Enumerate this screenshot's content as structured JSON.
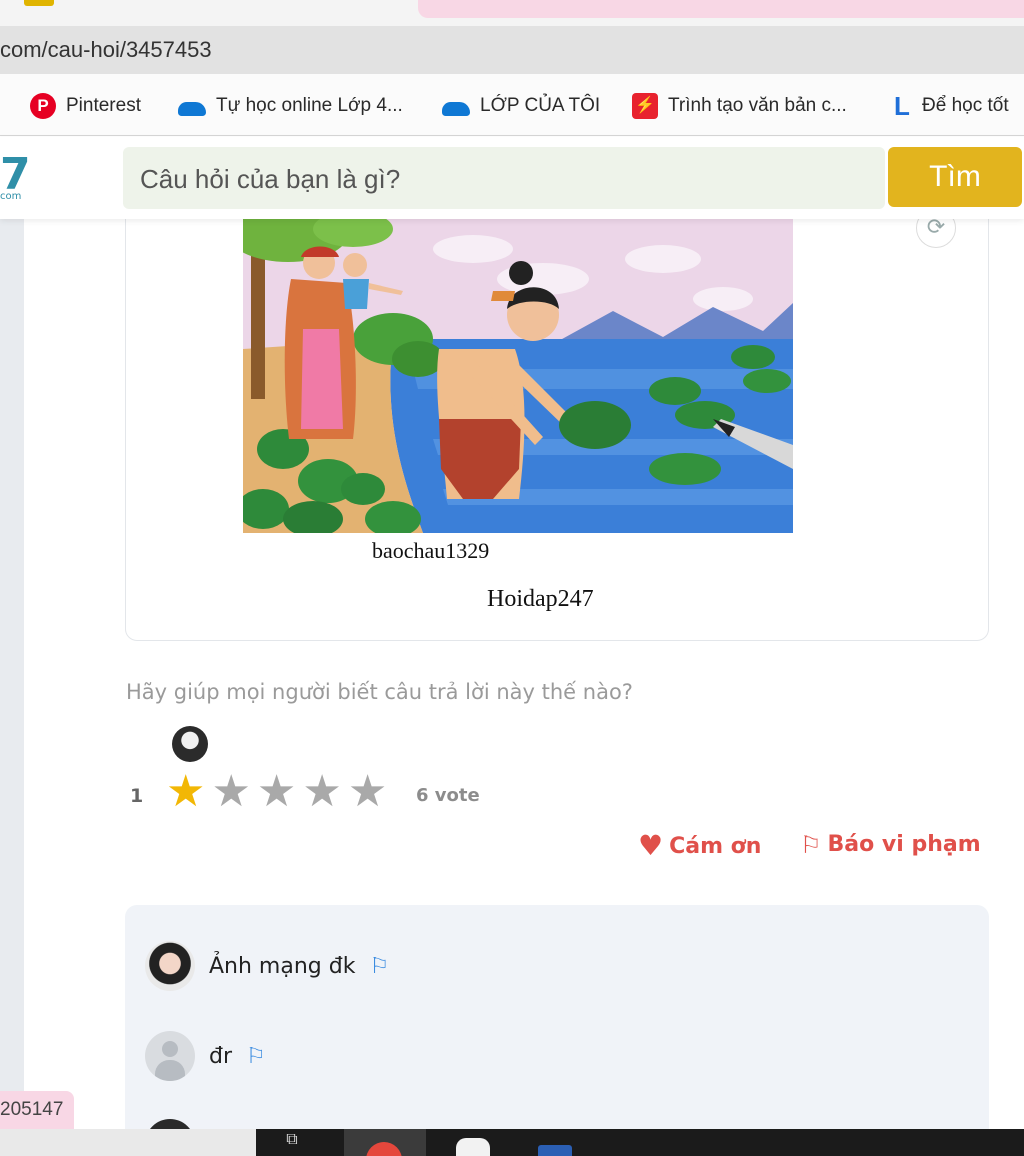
{
  "browser": {
    "url": "com/cau-hoi/3457453",
    "bookmarks": [
      {
        "label": "Pinterest",
        "icon": "pinterest-icon"
      },
      {
        "label": "Tự học online Lớp 4...",
        "icon": "cloud-icon"
      },
      {
        "label": "LỚP CỦA TÔI",
        "icon": "cloud-icon"
      },
      {
        "label": "Trình tạo văn bản c...",
        "icon": "bolt-icon"
      },
      {
        "label": "Để học tốt",
        "icon": "l-letter-icon"
      }
    ]
  },
  "header": {
    "logo_digit": "7",
    "logo_suffix": "com",
    "search_placeholder": "Câu hỏi của bạn là gì?",
    "search_button": "Tìm",
    "accent_color": "#e2b41e"
  },
  "answer": {
    "caption_user": "baochau1329",
    "caption_site": "Hoidap247"
  },
  "rating": {
    "prompt": "Hãy giúp mọi người biết câu trả lời này thế nào?",
    "count": "1",
    "stars_filled": 1,
    "stars_total": 5,
    "votes": "6 vote",
    "star_color": "#f2b705"
  },
  "actions": {
    "thanks": "Cám ơn",
    "report": "Báo vi phạm"
  },
  "comments": [
    {
      "text": "Ảnh mạng đk"
    },
    {
      "text": "đr"
    }
  ],
  "footer": {
    "badge": "205147"
  }
}
